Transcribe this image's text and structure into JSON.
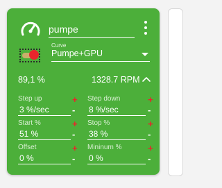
{
  "fan": {
    "name": "pumpe",
    "curve_label": "Curve",
    "curve_value": "Pumpe+GPU",
    "load": "89,1 %",
    "rpm": "1328.7 RPM"
  },
  "params": {
    "step_up": {
      "label": "Step up",
      "value": "3 %/sec"
    },
    "step_down": {
      "label": "Step down",
      "value": "8 %/sec"
    },
    "start": {
      "label": "Start %",
      "value": "51 %"
    },
    "stop": {
      "label": "Stop %",
      "value": "38 %"
    },
    "offset": {
      "label": "Offset",
      "value": "0 %"
    },
    "minimum": {
      "label": "Mininum %",
      "value": "0 %"
    }
  },
  "controls": {
    "plus": "+",
    "minus": "-"
  },
  "colors": {
    "card": "#4caf3a",
    "accent_red": "#e8262c",
    "toggle_track": "#c9ae6b"
  },
  "icons": {
    "gauge": "speedometer-icon",
    "menu": "more-vert-icon",
    "caret": "dropdown-caret-icon",
    "collapse": "chevron-up-icon"
  }
}
